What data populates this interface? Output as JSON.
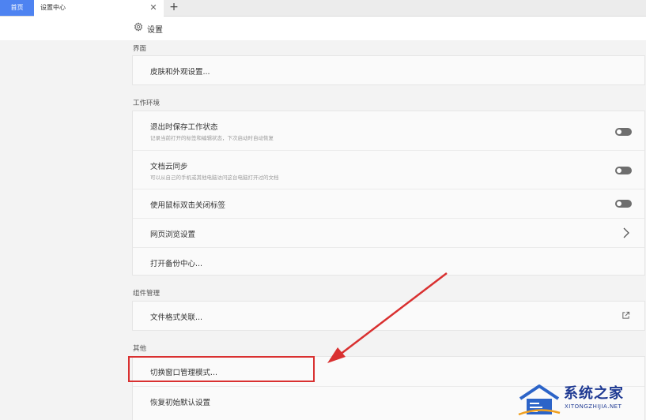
{
  "tabs": {
    "home_label": "首页",
    "active_label": "设置中心",
    "close_glyph": "✕",
    "add_glyph": "+"
  },
  "header": {
    "title": "设置",
    "icon": "gear-icon"
  },
  "sections": {
    "interface": {
      "label": "界面",
      "items": [
        {
          "label": "皮肤和外观设置..."
        }
      ]
    },
    "workspace": {
      "label": "工作环境",
      "items": [
        {
          "label": "退出时保存工作状态",
          "desc": "记录当前打开的标签和编辑状态，下次启动时自动恢复",
          "control": "toggle",
          "state": "off"
        },
        {
          "label": "文档云同步",
          "desc": "可以从自己的手机或其他电脑访问这台电脑打开过的文档",
          "control": "toggle",
          "state": "off"
        },
        {
          "label": "使用鼠标双击关闭标签",
          "control": "toggle",
          "state": "off"
        },
        {
          "label": "网页浏览设置",
          "control": "chevron"
        },
        {
          "label": "打开备份中心..."
        }
      ]
    },
    "components": {
      "label": "组件管理",
      "items": [
        {
          "label": "文件格式关联...",
          "control": "external-link"
        }
      ]
    },
    "other": {
      "label": "其他",
      "items": [
        {
          "label": "切换窗口管理模式..."
        },
        {
          "label": "恢复初始默认设置"
        }
      ]
    }
  },
  "annotation": {
    "box_color": "#d93030",
    "arrow_color": "#d93030"
  },
  "watermark": {
    "title": "系统之家",
    "subtitle": "XITONGZHIJIA.NET",
    "color": "#1f3a93"
  },
  "colors": {
    "accent": "#4e83f1",
    "toggle_off": "#6e6e6e"
  }
}
